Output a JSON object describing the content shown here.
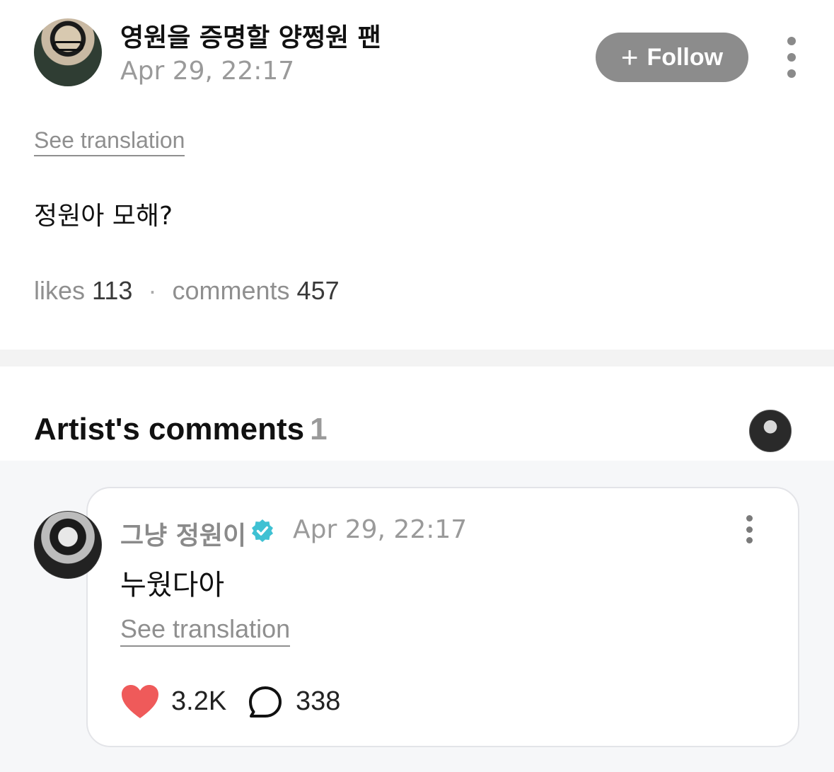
{
  "post": {
    "author_name": "영원을 증명할 양쩡원 팬",
    "timestamp": "Apr 29, 22:17",
    "follow_label": "Follow",
    "follow_icon": "+",
    "see_translation": "See translation",
    "body": "정원아 모해?",
    "likes_label": "likes",
    "likes_count": "113",
    "separator": "·",
    "comments_label": "comments",
    "comments_count": "457"
  },
  "artist_comments": {
    "title": "Artist's comments",
    "count": "1",
    "comment": {
      "author_name": "그냥 정원이",
      "timestamp": "Apr 29, 22:17",
      "body": "누웠다아",
      "see_translation": "See translation",
      "like_count": "3.2K",
      "reply_count": "338"
    }
  },
  "colors": {
    "follow_bg": "#8c8c8c",
    "heart": "#ef5a5a",
    "verified": "#3fc1d3",
    "muted_text": "#9a9a9a",
    "section_bg": "#f6f7f9"
  },
  "icons": {
    "follow": "plus-icon",
    "more": "more-vertical-icon",
    "verified": "verified-badge-icon",
    "like": "heart-icon",
    "reply": "speech-bubble-icon"
  }
}
